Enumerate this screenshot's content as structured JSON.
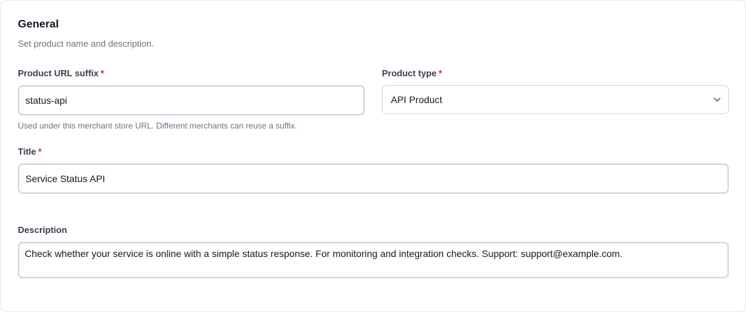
{
  "section": {
    "title": "General",
    "subtitle": "Set product name and description."
  },
  "url_suffix": {
    "label": "Product URL suffix",
    "required_mark": "*",
    "value": "status-api",
    "hint": "Used under this merchant store URL. Different merchants can reuse a suffix."
  },
  "product_type": {
    "label": "Product type",
    "required_mark": "*",
    "selected": "API Product",
    "icon": "chevron-down-icon"
  },
  "title_field": {
    "label": "Title",
    "required_mark": "*",
    "value": "Service Status API"
  },
  "description": {
    "label": "Description",
    "value": "Check whether your service is online with a simple status response. For monitoring and integration checks. Support: support@example.com."
  },
  "colors": {
    "required": "#dc2626",
    "label": "#374151",
    "muted": "#6b7280",
    "border": "#d1d5db"
  }
}
